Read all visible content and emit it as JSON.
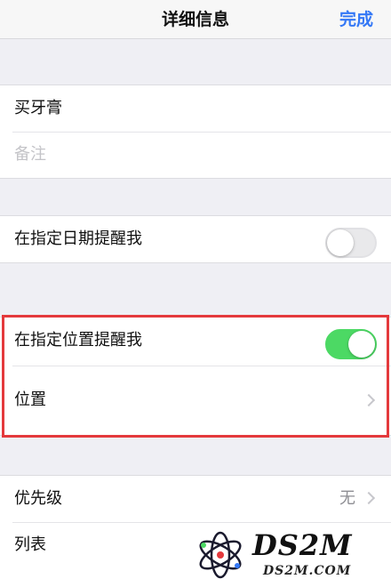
{
  "nav": {
    "title": "详细信息",
    "done": "完成",
    "accent_color": "#3478f6"
  },
  "task": {
    "title": "买牙膏",
    "notes_placeholder": "备注"
  },
  "date_reminder": {
    "label": "在指定日期提醒我",
    "enabled": false
  },
  "location_reminder": {
    "label": "在指定位置提醒我",
    "enabled": true,
    "location_label": "位置",
    "toggle_on_color": "#4cd964",
    "highlight_color": "#e4393c"
  },
  "details": {
    "priority_label": "优先级",
    "priority_value": "无",
    "list_label": "列表"
  },
  "watermark": {
    "main": "DS2M",
    "sub": "DS2M.COM"
  }
}
